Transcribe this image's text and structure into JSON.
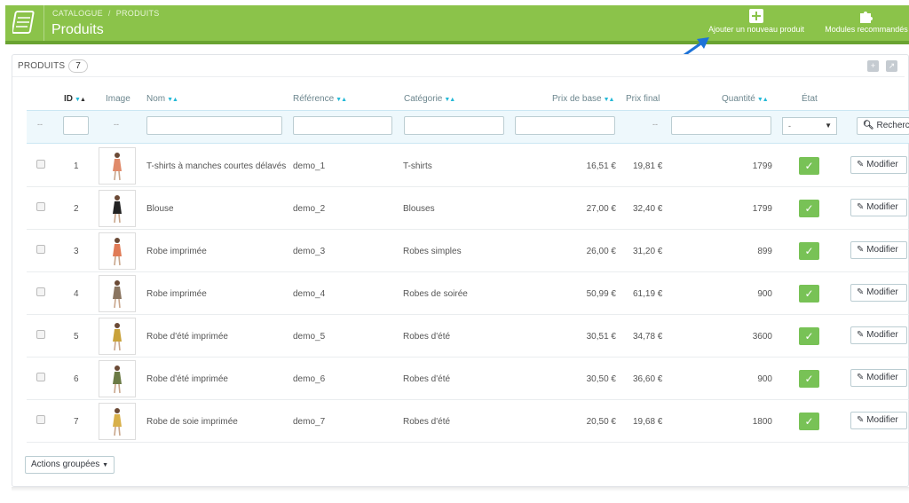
{
  "header": {
    "breadcrumb": [
      "CATALOGUE",
      "PRODUITS"
    ],
    "title": "Produits",
    "add_product_label": "Ajouter un nouveau produit",
    "modules_label": "Modules recommandés",
    "accent_color": "#8bc34a"
  },
  "panel": {
    "heading": "PRODUITS",
    "count": "7"
  },
  "table": {
    "columns": {
      "id": "ID",
      "image": "Image",
      "name": "Nom",
      "reference": "Référence",
      "category": "Catégorie",
      "base_price": "Prix de base",
      "final_price": "Prix final",
      "quantity": "Quantité",
      "status": "État"
    },
    "filter": {
      "dash_left": "--",
      "dash_image": "--",
      "dash_final": "--",
      "status_select": "-",
      "search_label": "Rechercher"
    },
    "edit_label": "Modifier",
    "rows": [
      {
        "id": "1",
        "name": "T-shirts à manches courtes délavés",
        "reference": "demo_1",
        "category": "T-shirts",
        "base_price": "16,51 €",
        "final_price": "19,81 €",
        "quantity": "1799"
      },
      {
        "id": "2",
        "name": "Blouse",
        "reference": "demo_2",
        "category": "Blouses",
        "base_price": "27,00 €",
        "final_price": "32,40 €",
        "quantity": "1799"
      },
      {
        "id": "3",
        "name": "Robe imprimée",
        "reference": "demo_3",
        "category": "Robes simples",
        "base_price": "26,00 €",
        "final_price": "31,20 €",
        "quantity": "899"
      },
      {
        "id": "4",
        "name": "Robe imprimée",
        "reference": "demo_4",
        "category": "Robes de soirée",
        "base_price": "50,99 €",
        "final_price": "61,19 €",
        "quantity": "900"
      },
      {
        "id": "5",
        "name": "Robe d'été imprimée",
        "reference": "demo_5",
        "category": "Robes d'été",
        "base_price": "30,51 €",
        "final_price": "34,78 €",
        "quantity": "3600"
      },
      {
        "id": "6",
        "name": "Robe d'été imprimée",
        "reference": "demo_6",
        "category": "Robes d'été",
        "base_price": "30,50 €",
        "final_price": "36,60 €",
        "quantity": "900"
      },
      {
        "id": "7",
        "name": "Robe de soie imprimée",
        "reference": "demo_7",
        "category": "Robes d'été",
        "base_price": "20,50 €",
        "final_price": "19,68 €",
        "quantity": "1800"
      }
    ]
  },
  "footer": {
    "bulk_actions": "Actions groupées"
  }
}
